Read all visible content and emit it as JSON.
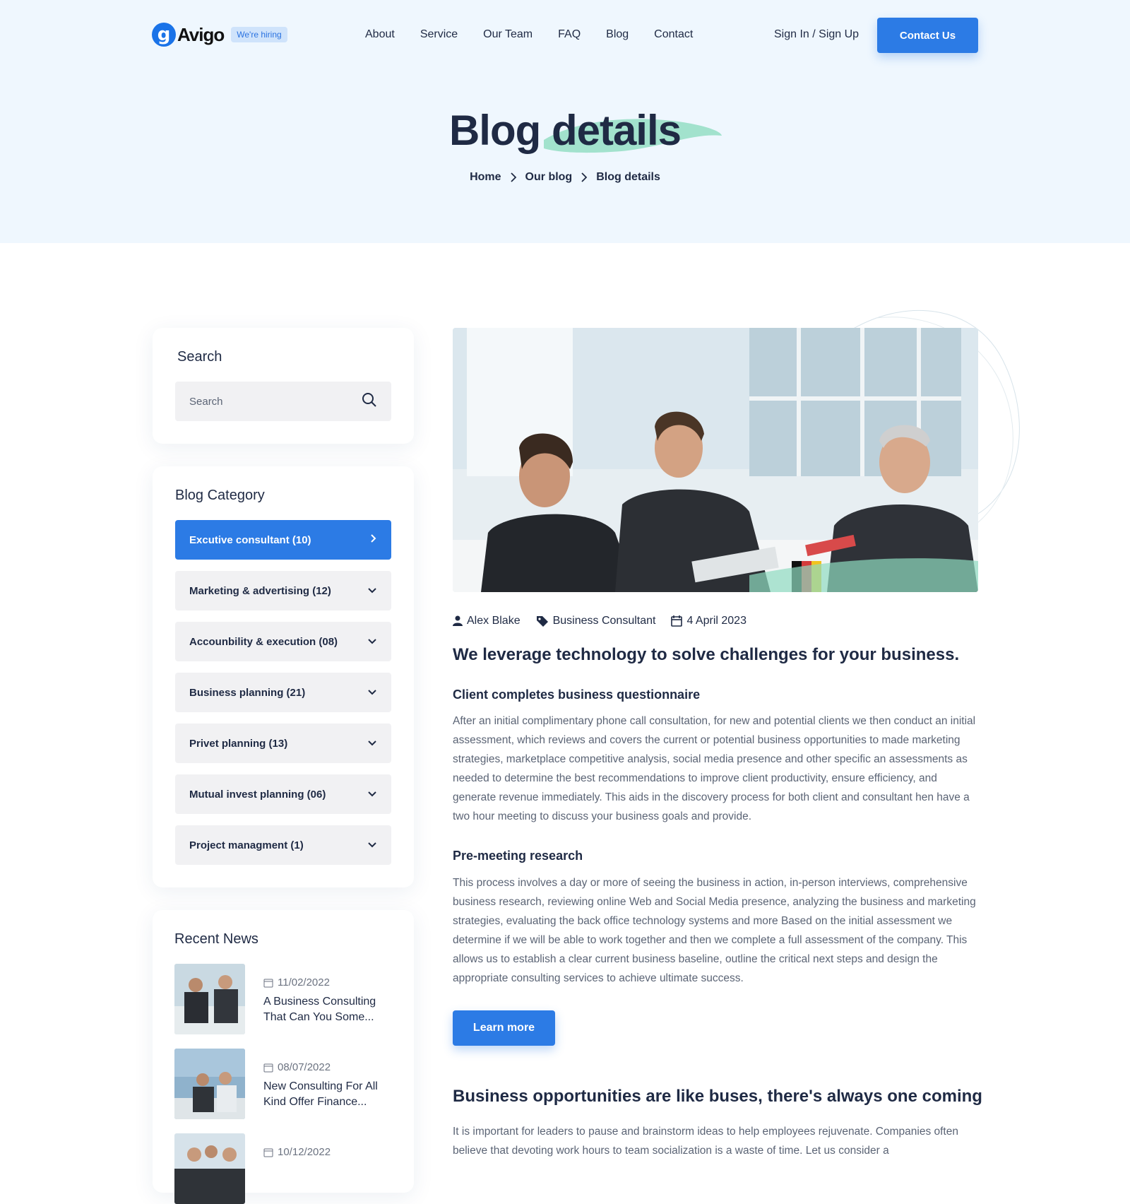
{
  "header": {
    "logo_mark": "g",
    "logo_text": "Avigo",
    "hiring_badge": "We're hiring",
    "nav": [
      "About",
      "Service",
      "Our Team",
      "FAQ",
      "Blog",
      "Contact"
    ],
    "signin": "Sign In / Sign Up",
    "contact_btn": "Contact Us"
  },
  "hero": {
    "title": "Blog details",
    "breadcrumb": [
      "Home",
      "Our blog",
      "Blog details"
    ]
  },
  "sidebar": {
    "search_title": "Search",
    "search_placeholder": "Search",
    "category_title": "Blog Category",
    "categories": [
      {
        "label": "Excutive consultant (10)"
      },
      {
        "label": "Marketing & advertising (12)"
      },
      {
        "label": "Accounbility & execution (08)"
      },
      {
        "label": "Business planning (21)"
      },
      {
        "label": "Privet planning (13)"
      },
      {
        "label": "Mutual invest planning (06)"
      },
      {
        "label": "Project managment  (1)"
      }
    ],
    "news_title": "Recent News",
    "news": [
      {
        "date": "11/02/2022",
        "title": "A Business Consulting That Can You Some..."
      },
      {
        "date": "08/07/2022",
        "title": "New Consulting For All Kind Offer Finance..."
      },
      {
        "date": "10/12/2022",
        "title": ""
      }
    ]
  },
  "post": {
    "author": "Alex Blake",
    "tag": "Business Consultant",
    "date": "4 April 2023",
    "headline": "We leverage technology to solve challenges for your business.",
    "section1_title": "Client completes business questionnaire",
    "section1_body": "After an initial complimentary phone call consultation, for new and potential clients we then conduct an initial assessment, which reviews and covers the current or potential business opportunities to made marketing strategies, marketplace competitive analysis, social media presence and other specific an assessments as needed to determine the best recommendations to improve client productivity, ensure efficiency, and generate revenue immediately. This aids in the discovery process for both client and consultant hen have a two hour meeting to discuss your business goals and provide.",
    "section2_title": "Pre-meeting research",
    "section2_body": "This process involves a day or more of seeing the business in action, in-person interviews, comprehensive business research, reviewing online Web and Social Media presence, analyzing the business and marketing strategies, evaluating the back office technology systems and more Based on the initial assessment we determine if we will be able to work together and then we complete a full assessment of the company. This allows us to establish a clear current business baseline, outline the critical next steps and design the appropriate consulting services to achieve ultimate success.",
    "learn_more": "Learn more",
    "section3_title": "Business opportunities are like buses, there's always one coming",
    "section3_body": "It is important for leaders to pause and brainstorm ideas to help employees rejuvenate. Companies often believe that devoting work hours to team socialization is a waste of time. Let us consider a"
  },
  "colors": {
    "accent": "#2c7be5",
    "hero_bg": "#eff7fe",
    "brush": "#8fdcc0"
  }
}
